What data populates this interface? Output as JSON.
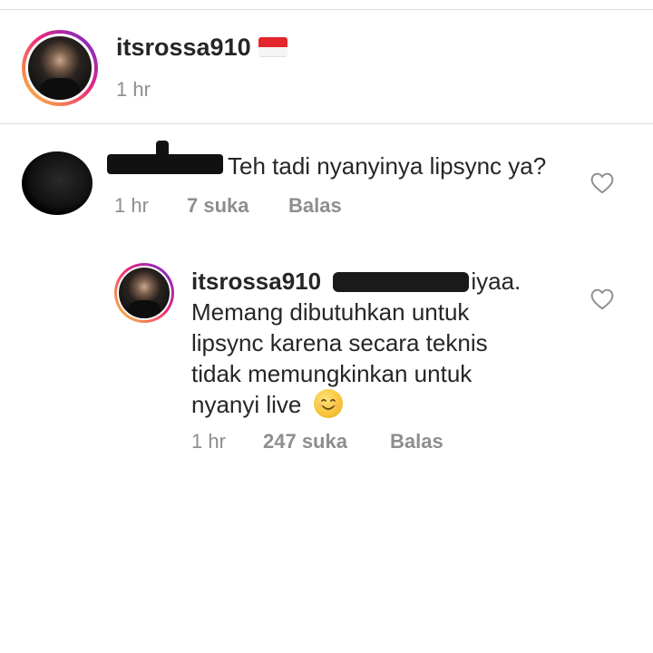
{
  "post_header": {
    "username": "itsrossa910",
    "time": "1 hr",
    "flag_icon": "indonesia-flag-icon"
  },
  "comment": {
    "text": "Teh tadi nyanyinya lipsync ya?",
    "time": "1 hr",
    "likes": "7 suka",
    "reply_label": "Balas",
    "like_icon": "heart-outline-icon"
  },
  "reply": {
    "username": "itsrossa910",
    "text_after_mention": "iyaa. Memang dibutuhkan untuk lipsync  karena secara teknis tidak memungkinkan untuk nyanyi live",
    "emoji": "smiling-face-icon",
    "time": "1 hr",
    "likes": "247 suka",
    "reply_label": "Balas",
    "like_icon": "heart-outline-icon"
  },
  "colors": {
    "text": "#262626",
    "meta": "#8e8e8e",
    "divider": "#dbdbdb"
  }
}
